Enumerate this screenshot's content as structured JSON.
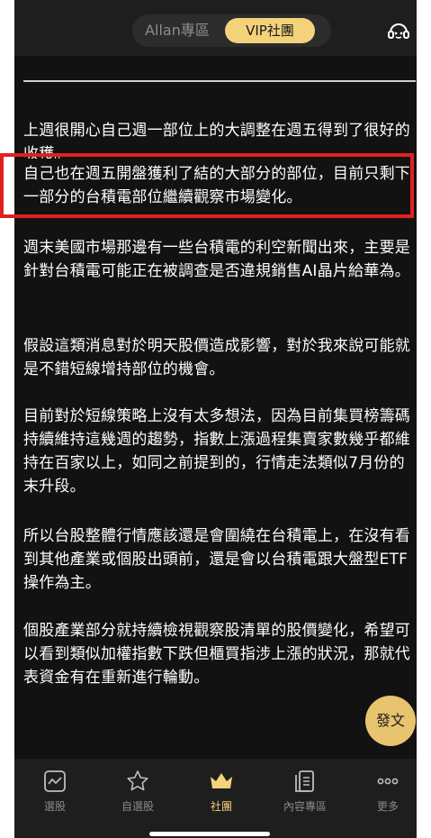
{
  "header": {
    "tab_left": "Allan專區",
    "tab_right": "VIP社團",
    "support_icon": "customer-service-icon"
  },
  "colors": {
    "accent": "#f3d27a",
    "background": "#121212",
    "highlight": "#e02020"
  },
  "post": {
    "paragraphs": [
      "上週很開心自己週一部位上的大調整在週五得到了很好的收穫。",
      "自己也在週五開盤獲利了結的大部分的部位，目前只剩下一部分的台積電部位繼續觀察市場變化。",
      "週末美國市場那邊有一些台積電的利空新聞出來，主要是針對台積電可能正在被調查是否違規銷售AI晶片給華為。",
      "假設這類消息對於明天股價造成影響，對於我來說可能就是不錯短線增持部位的機會。",
      "目前對於短線策略上沒有太多想法，因為目前集買榜籌碼持續維持這幾週的趨勢，指數上漲過程集賣家數幾乎都維持在百家以上，如同之前提到的，行情走法類似7月份的末升段。",
      "所以台股整體行情應該還是會圍繞在台積電上，在沒有看到其他產業或個股出頭前，還是會以台積電跟大盤型ETF操作為主。",
      "個股產業部分就持續檢視觀察股清單的股價變化，希望可以看到類似加權指數下跌但櫃買指涉上漲的狀況，那就代表資金有在重新進行輪動。"
    ]
  },
  "fab_label": "發文",
  "tabbar": {
    "items": [
      {
        "label": "選股",
        "icon": "chart-icon"
      },
      {
        "label": "自選股",
        "icon": "star-icon"
      },
      {
        "label": "社團",
        "icon": "crown-icon"
      },
      {
        "label": "內容專區",
        "icon": "document-icon"
      },
      {
        "label": "更多",
        "icon": "more-icon"
      }
    ],
    "active": "社團"
  }
}
